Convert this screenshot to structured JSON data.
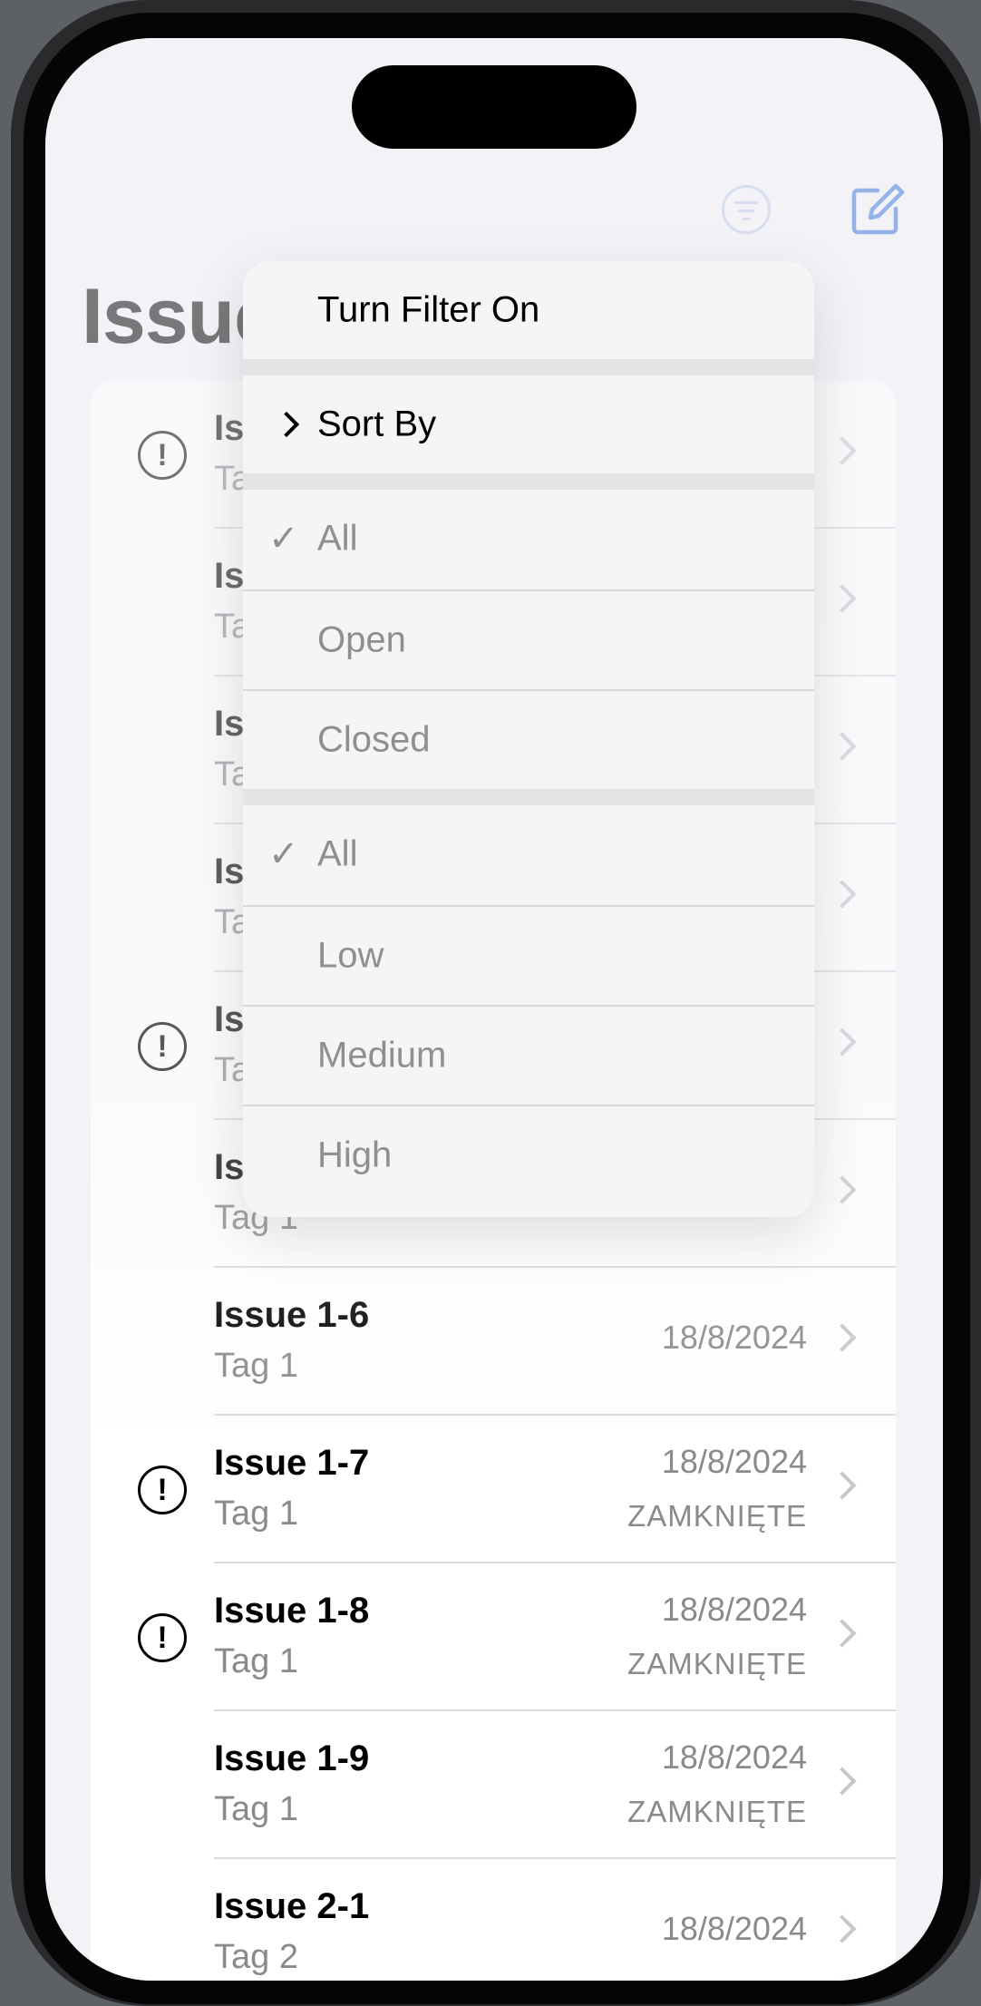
{
  "header": {
    "title": "Issues",
    "filter_icon": "filter-circle-icon",
    "compose_icon": "square-and-pencil-icon"
  },
  "filter_menu": {
    "turn_filter_on": "Turn Filter On",
    "sort_by": "Sort By",
    "status_options": [
      {
        "label": "All",
        "checked": true
      },
      {
        "label": "Open",
        "checked": false
      },
      {
        "label": "Closed",
        "checked": false
      }
    ],
    "priority_options": [
      {
        "label": "All",
        "checked": true
      },
      {
        "label": "Low",
        "checked": false
      },
      {
        "label": "Medium",
        "checked": false
      },
      {
        "label": "High",
        "checked": false
      }
    ],
    "check_glyph": "✓"
  },
  "issues": [
    {
      "title": "Issue 1-0",
      "tag": "Tag 1",
      "date": "",
      "status": "",
      "high_priority": true
    },
    {
      "title": "Issue 1-1",
      "tag": "Tag 1",
      "date": "",
      "status": "",
      "high_priority": false
    },
    {
      "title": "Issue 1-2",
      "tag": "Tag 1",
      "date": "",
      "status": "",
      "high_priority": false
    },
    {
      "title": "Issue 1-3",
      "tag": "Tag 1",
      "date": "",
      "status": "",
      "high_priority": false
    },
    {
      "title": "Issue 1-4",
      "tag": "Tag 1",
      "date": "",
      "status": "",
      "high_priority": true
    },
    {
      "title": "Issue 1-5",
      "tag": "Tag 1",
      "date": "",
      "status": "",
      "high_priority": false
    },
    {
      "title": "Issue 1-6",
      "tag": "Tag 1",
      "date": "18/8/2024",
      "status": "",
      "high_priority": false
    },
    {
      "title": "Issue 1-7",
      "tag": "Tag 1",
      "date": "18/8/2024",
      "status": "ZAMKNIĘTE",
      "high_priority": true
    },
    {
      "title": "Issue 1-8",
      "tag": "Tag 1",
      "date": "18/8/2024",
      "status": "ZAMKNIĘTE",
      "high_priority": true
    },
    {
      "title": "Issue 1-9",
      "tag": "Tag 1",
      "date": "18/8/2024",
      "status": "ZAMKNIĘTE",
      "high_priority": false
    },
    {
      "title": "Issue 2-1",
      "tag": "Tag 2",
      "date": "18/8/2024",
      "status": "",
      "high_priority": false
    }
  ],
  "alert_glyph": "!",
  "colors": {
    "accent": "#2f6fd6",
    "filter_icon": "#b9c9e6",
    "secondary_text": "#8a8a8e",
    "background": "#f2f2f7"
  }
}
